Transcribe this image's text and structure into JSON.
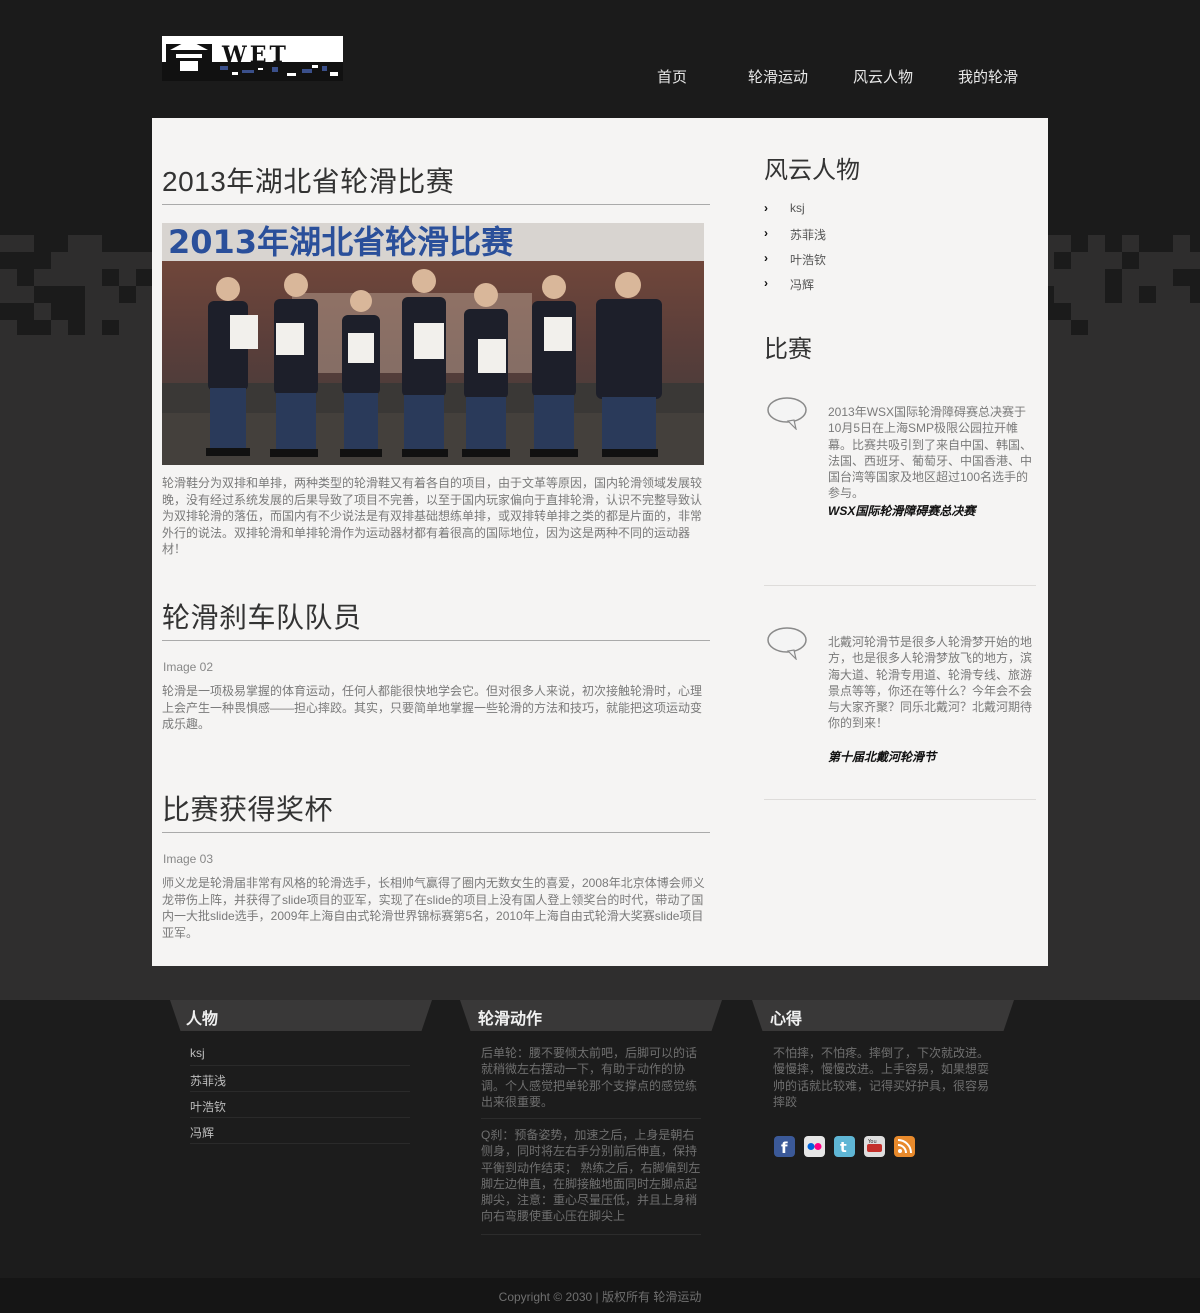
{
  "nav": {
    "items": [
      {
        "label": "首页"
      },
      {
        "label": "轮滑运动"
      },
      {
        "label": "风云人物"
      },
      {
        "label": "我的轮滑"
      }
    ]
  },
  "logo": {
    "text": "WET"
  },
  "articles": [
    {
      "title": "2013年湖北省轮滑比赛",
      "photo_banner": "2013年湖北省轮滑比赛",
      "body": "轮滑鞋分为双排和单排，两种类型的轮滑鞋又有着各自的项目，由于文革等原因，国内轮滑领域发展较晚，没有经过系统发展的后果导致了项目不完善，以至于国内玩家偏向于直排轮滑，认识不完整导致认为双排轮滑的落伍，而国内有不少说法是有双排基础想练单排，或双排转单排之类的都是片面的，非常外行的说法。双排轮滑和单排轮滑作为运动器材都有着很高的国际地位，因为这是两种不同的运动器材！"
    },
    {
      "title": "轮滑刹车队队员",
      "image_alt": "Image 02",
      "body": "轮滑是一项极易掌握的体育运动，任何人都能很快地学会它。但对很多人来说，初次接触轮滑时，心理上会产生一种畏惧感——担心摔跤。其实，只要简单地掌握一些轮滑的方法和技巧，就能把这项运动变成乐趣。"
    },
    {
      "title": "比赛获得奖杯",
      "image_alt": "Image 03",
      "body": "师义龙是轮滑届非常有风格的轮滑选手，长相帅气赢得了圈内无数女生的喜爱，2008年北京体博会师义龙带伤上阵，并获得了slide项目的亚军，实现了在slide的项目上没有国人登上领奖台的时代，带动了国内一大批slide选手，2009年上海自由式轮滑世界锦标赛第5名，2010年上海自由式轮滑大奖赛slide项目亚军。"
    }
  ],
  "sidebar": {
    "people_title": "风云人物",
    "people": [
      {
        "name": "ksj"
      },
      {
        "name": "苏菲浅"
      },
      {
        "name": "叶浩钦"
      },
      {
        "name": "冯辉"
      }
    ],
    "matches_title": "比赛",
    "matches": [
      {
        "text": "2013年WSX国际轮滑障碍赛总决赛于10月5日在上海SMP极限公园拉开帷幕。比赛共吸引到了来自中国、韩国、法国、西班牙、葡萄牙、中国香港、中国台湾等国家及地区超过100名选手的参与。",
        "title": "WSX国际轮滑障碍赛总决赛"
      },
      {
        "text": "北戴河轮滑节是很多人轮滑梦开始的地方，也是很多人轮滑梦放飞的地方，滨海大道、轮滑专用道、轮滑专线、旅游景点等等，你还在等什么？今年会不会与大家齐聚？同乐北戴河？北戴河期待你的到来！",
        "title": "第十届北戴河轮滑节"
      }
    ]
  },
  "footer": {
    "people": {
      "title": "人物",
      "items": [
        {
          "name": "ksj"
        },
        {
          "name": "苏菲浅"
        },
        {
          "name": "叶浩钦"
        },
        {
          "name": "冯辉"
        }
      ]
    },
    "moves": {
      "title": "轮滑动作",
      "paragraphs": [
        "后单轮：腰不要倾太前吧，后脚可以的话就稍微左右摆动一下，有助于动作的协调。个人感觉把单轮那个支撑点的感觉练出来很重要。",
        "Q刹：预备姿势，加速之后，上身是朝右侧身，同时将左右手分别前后伸直，保持平衡到动作结束； 熟练之后，右脚偏到左脚左边伸直，在脚接触地面同时左脚点起脚尖，注意：重心尽量压低，并且上身稍向右弯腰使重心压在脚尖上"
      ]
    },
    "thoughts": {
      "title": "心得",
      "text": "不怕摔，不怕疼。摔倒了，下次就改进。慢慢摔，慢慢改进。上手容易，如果想耍帅的话就比较难，记得买好护具，很容易摔跤"
    },
    "social": [
      {
        "icon": "facebook-icon",
        "color": "#3b5998",
        "glyph": "f"
      },
      {
        "icon": "flickr-icon",
        "color": "#e0e0e0",
        "glyph": "••"
      },
      {
        "icon": "twitter-icon",
        "color": "#5fb6d5",
        "glyph": "t"
      },
      {
        "icon": "youtube-icon",
        "color": "#d8d8d8",
        "glyph": "You"
      },
      {
        "icon": "rss-icon",
        "color": "#e88a2c",
        "glyph": ")"
      }
    ]
  },
  "copyright": "Copyright © 2030 | 版权所有 轮滑运动"
}
